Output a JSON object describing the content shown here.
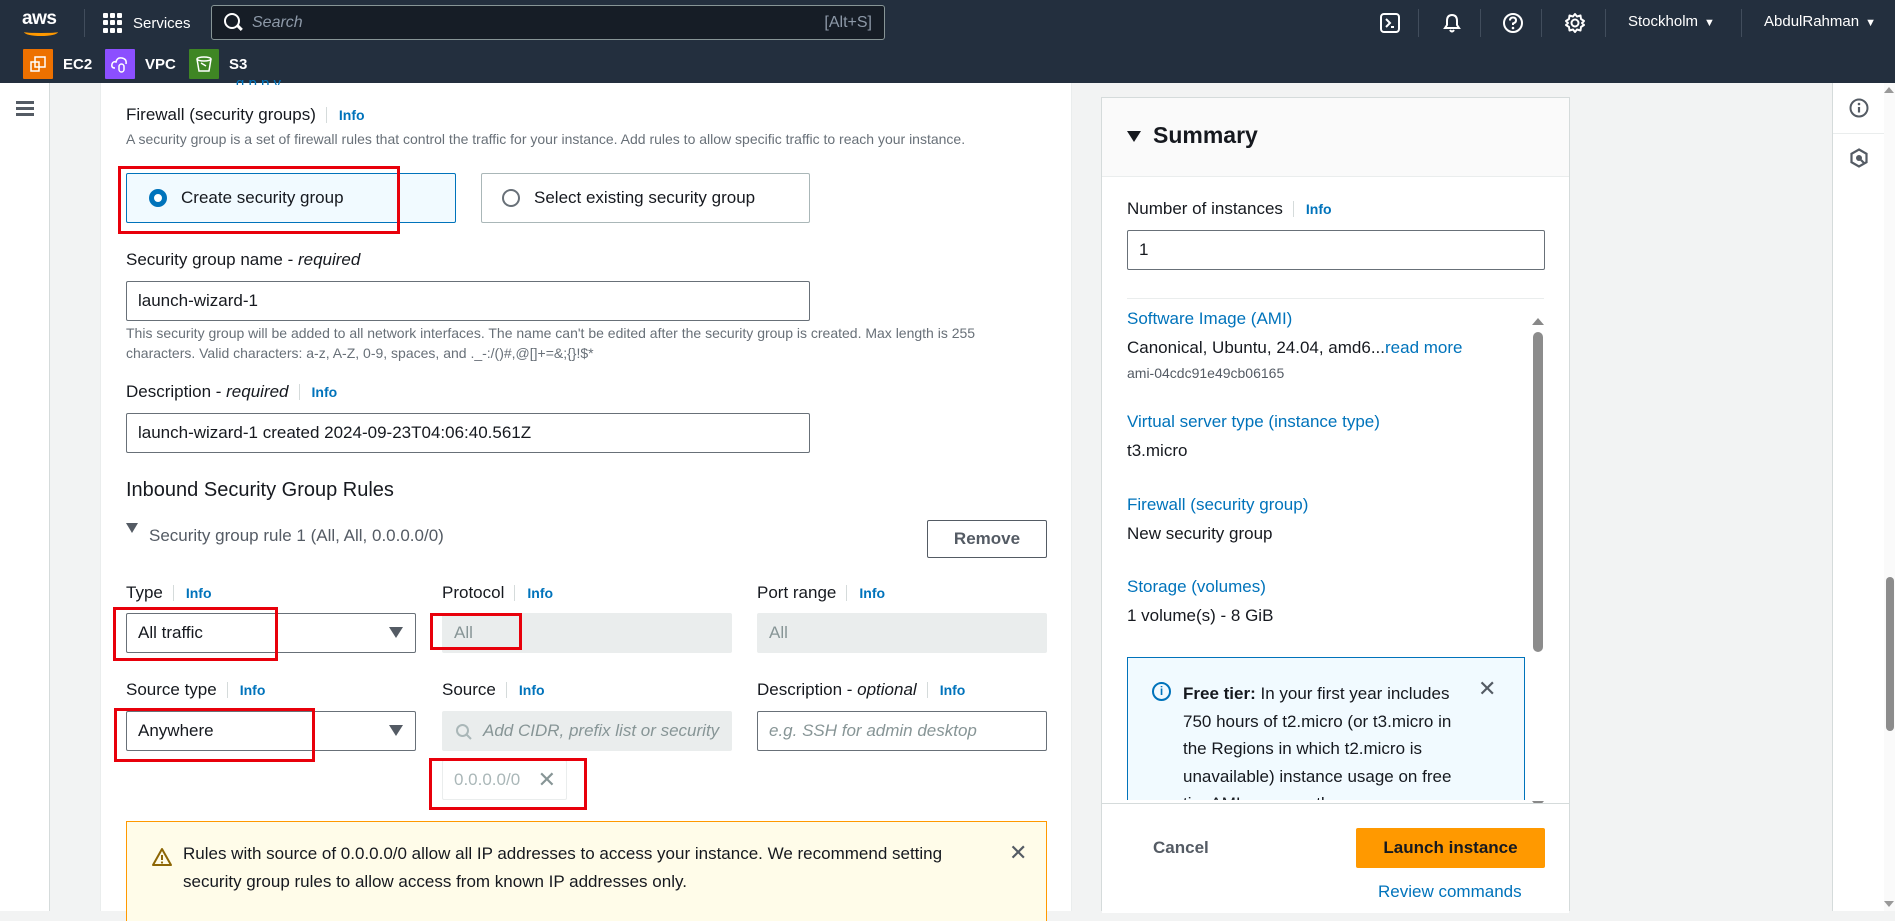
{
  "topnav": {
    "logo": "aws",
    "services_label": "Services",
    "search_placeholder": "Search",
    "search_shortcut": "[Alt+S]",
    "icons": [
      "cloudshell-icon",
      "bell-icon",
      "help-icon",
      "gear-icon"
    ],
    "region": "Stockholm",
    "user": "AbdulRahman",
    "favorites": [
      {
        "label": "EC2",
        "icon": "ec2-icon",
        "color": "#ed7100"
      },
      {
        "label": "VPC",
        "icon": "vpc-icon",
        "color": "#8c4fff"
      },
      {
        "label": "S3",
        "icon": "s3-icon",
        "color": "#3f8624"
      }
    ]
  },
  "firewall": {
    "title": "Firewall (security groups)",
    "info": "Info",
    "description": "A security group is a set of firewall rules that control the traffic for your instance. Add rules to allow specific traffic to reach your instance.",
    "options": [
      {
        "label": "Create security group",
        "selected": true
      },
      {
        "label": "Select existing security group",
        "selected": false
      }
    ]
  },
  "sg_name": {
    "label": "Security group name - ",
    "req": "required",
    "value": "launch-wizard-1",
    "help": "This security group will be added to all network interfaces. The name can't be edited after the security group is created. Max length is 255 characters. Valid characters: a-z, A-Z, 0-9, spaces, and ._-:/()#,@[]+=&;{}!$*"
  },
  "sg_description": {
    "label": "Description - ",
    "req": "required",
    "info": "Info",
    "value": "launch-wizard-1 created 2024-09-23T04:06:40.561Z"
  },
  "inbound": {
    "title": "Inbound Security Group Rules",
    "rule_title": "Security group rule 1 (All, All, 0.0.0.0/0)",
    "remove": "Remove",
    "type": {
      "label": "Type",
      "info": "Info",
      "value": "All traffic"
    },
    "protocol": {
      "label": "Protocol",
      "info": "Info",
      "value": "All"
    },
    "port_range": {
      "label": "Port range",
      "info": "Info",
      "value": "All"
    },
    "source_type": {
      "label": "Source type",
      "info": "Info",
      "value": "Anywhere"
    },
    "source": {
      "label": "Source",
      "info": "Info",
      "placeholder": "Add CIDR, prefix list or security",
      "token": "0.0.0.0/0"
    },
    "rule_description": {
      "label": "Description - ",
      "opt": "optional",
      "info": "Info",
      "placeholder": "e.g. SSH for admin desktop"
    }
  },
  "warning": {
    "text": "Rules with source of 0.0.0.0/0 allow all IP addresses to access your instance. We recommend setting security group rules to allow access from known IP addresses only."
  },
  "summary": {
    "title": "Summary",
    "instances_label": "Number of instances",
    "instances_info": "Info",
    "instances_value": "1",
    "ami_label": "Software Image (AMI)",
    "ami_value": "Canonical, Ubuntu, 24.04, amd6...",
    "ami_read_more": "read more",
    "ami_id": "ami-04cdc91e49cb06165",
    "type_label": "Virtual server type (instance type)",
    "type_value": "t3.micro",
    "fw_label": "Firewall (security group)",
    "fw_value": "New security group",
    "storage_label": "Storage (volumes)",
    "storage_value": "1 volume(s) - 8 GiB",
    "free_tier_bold": "Free tier:",
    "free_tier_text": " In your first year includes 750 hours of t2.micro (or t3.micro in the Regions in which t2.micro is unavailable) instance usage on free tier AMIs per month",
    "cancel": "Cancel",
    "launch": "Launch instance",
    "review": "Review commands"
  },
  "tools": [
    "info-icon",
    "feedback-icon"
  ]
}
